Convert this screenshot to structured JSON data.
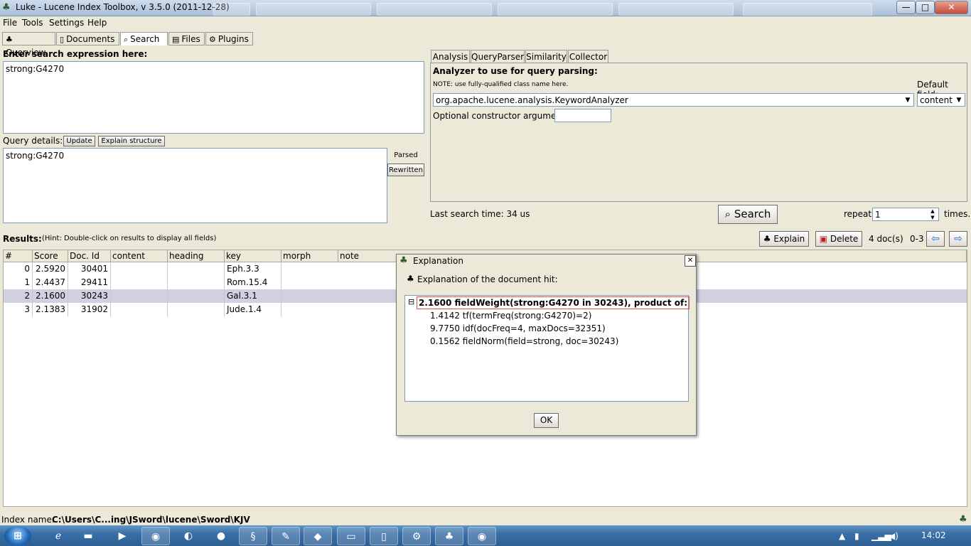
{
  "window": {
    "title": "Luke - Lucene Index Toolbox, v 3.5.0 (2011-12-28)",
    "minimize_glyph": "—",
    "maximize_glyph": "□",
    "close_glyph": "✕"
  },
  "menu": [
    "File",
    "Tools",
    "Settings",
    "Help"
  ],
  "main_tabs": [
    "Overview",
    "Documents",
    "Search",
    "Files",
    "Plugins"
  ],
  "search": {
    "expr_label": "Enter search expression here:",
    "expr_value": "strong:G4270",
    "details_label": "Query details:",
    "update_label": "Update",
    "explain_structure_label": "Explain structure",
    "details_value": "strong:G4270",
    "parsed_label": "Parsed",
    "rewritten_label": "Rewritten"
  },
  "analysis": {
    "tabs": [
      "Analysis",
      "QueryParser",
      "Similarity",
      "Collector"
    ],
    "analyzer_label": "Analyzer to use for query parsing:",
    "note": "NOTE: use fully-qualified class name here.",
    "default_field_label": "Default field:",
    "analyzer_value": "org.apache.lucene.analysis.KeywordAnalyzer",
    "default_field_value": "content",
    "ctor_label": "Optional constructor argument:",
    "ctor_value": ""
  },
  "search_bar": {
    "last_time": "Last search time: 34 us",
    "search_label": "Search",
    "repeat_label": "repeat",
    "repeat_value": "1",
    "times_label": "times."
  },
  "results": {
    "label": "Results:",
    "hint": "(Hint: Double-click on results to display all fields)",
    "explain_label": "Explain",
    "delete_label": "Delete",
    "doc_count": "4 doc(s)",
    "range": "0-3",
    "columns": [
      "#",
      "Score",
      "Doc. Id",
      "content",
      "heading",
      "key",
      "morph",
      "note"
    ],
    "rows": [
      {
        "n": "0",
        "score": "2.5920",
        "doc": "30401",
        "key": "Eph.3.3"
      },
      {
        "n": "1",
        "score": "2.4437",
        "doc": "29411",
        "key": "Rom.15.4"
      },
      {
        "n": "2",
        "score": "2.1600",
        "doc": "30243",
        "key": "Gal.3.1"
      },
      {
        "n": "3",
        "score": "2.1383",
        "doc": "31902",
        "key": "Jude.1.4"
      }
    ]
  },
  "dialog": {
    "title": "Explanation",
    "header": "Explanation of the document hit:",
    "root": "2.1600  fieldWeight(strong:G4270 in 30243), product of:",
    "children": [
      "1.4142  tf(termFreq(strong:G4270)=2)",
      "9.7750  idf(docFreq=4, maxDocs=32351)",
      "0.1562  fieldNorm(field=strong, doc=30243)"
    ],
    "ok_label": "OK",
    "close_glyph": "✕",
    "expander_glyph": "⊟"
  },
  "status": {
    "index_label": "Index name:",
    "index_value": "C:\\Users\\C...ing\\JSword\\lucene\\Sword\\KJV"
  },
  "taskbar": {
    "clock": "14:02"
  },
  "colors": {
    "window_bg": "#ece9d8",
    "selected_row": "#d0d0e0",
    "taskbar": "#3a6ea5",
    "highlight_border": "#e05050"
  }
}
